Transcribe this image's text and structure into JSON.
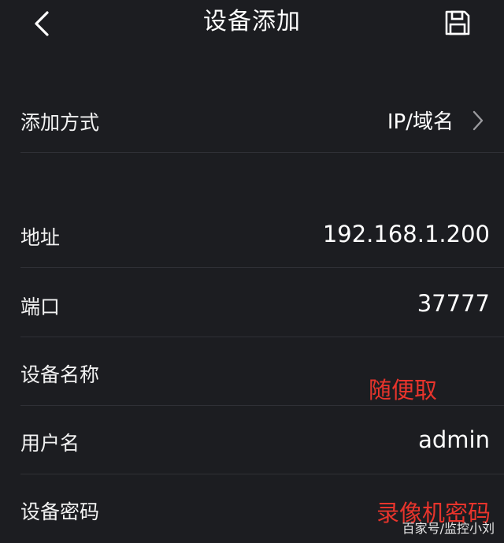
{
  "header": {
    "title": "设备添加"
  },
  "add_method": {
    "label": "添加方式",
    "value": "IP/域名"
  },
  "fields": {
    "address": {
      "label": "地址",
      "value": "192.168.1.200"
    },
    "port": {
      "label": "端口",
      "value": "37777"
    },
    "device_name": {
      "label": "设备名称",
      "value": ""
    },
    "username": {
      "label": "用户名",
      "value": "admin"
    },
    "password": {
      "label": "设备密码",
      "value": ""
    }
  },
  "annotations": {
    "device_name_note": "随便取",
    "password_note": "录像机密码"
  },
  "watermark": "百家号/监控小刘",
  "colors": {
    "background": "#1c1d21",
    "annotation": "#e8342c",
    "divider": "#2f3036"
  },
  "icons": {
    "back": "chevron-left-icon",
    "save": "floppy-disk-icon",
    "more": "chevron-right-icon"
  }
}
